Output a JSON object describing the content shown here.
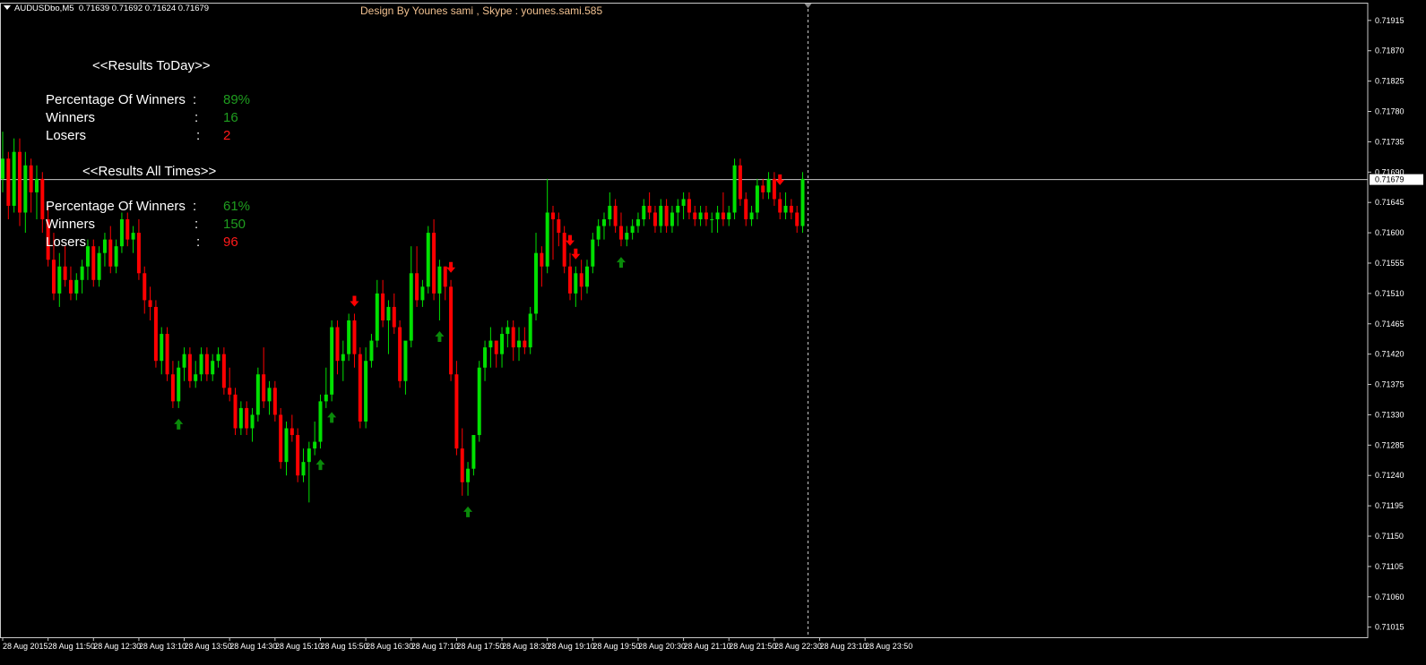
{
  "header": {
    "symbol": "AUDUSDbo,M5",
    "ohlc": "0.71639 0.71692 0.71624 0.71679",
    "design_credit": "Design By Younes sami , Skype : younes.sami.585"
  },
  "panel": {
    "today": {
      "title": "<<Results ToDay>>",
      "percentage_label": "Percentage Of Winners",
      "percentage_value": "89%",
      "winners_label": "Winners",
      "winners_value": "16",
      "losers_label": "Losers",
      "losers_value": "2"
    },
    "all_times": {
      "title": "<<Results All Times>>",
      "percentage_label": "Percentage Of Winners",
      "percentage_value": "61%",
      "winners_label": "Winners",
      "winners_value": "150",
      "losers_label": "Losers",
      "losers_value": "96"
    }
  },
  "colors": {
    "background": "#000000",
    "bull": "#00e000",
    "bear": "#ff0000",
    "up_arrow": "#0a8a0a",
    "down_arrow": "#ff0000",
    "axis": "#c8c8c8",
    "price_line": "#c8c8c8",
    "win_text": "#1f9d1f",
    "loss_text": "#ff1a1a"
  },
  "chart_data": {
    "type": "candlestick",
    "symbol": "AUDUSDbo",
    "timeframe": "M5",
    "ylim": [
      0.71,
      0.7194
    ],
    "y_ticks": [
      "0.71915",
      "0.71870",
      "0.71825",
      "0.71780",
      "0.71735",
      "0.71690",
      "0.71645",
      "0.71600",
      "0.71555",
      "0.71510",
      "0.71465",
      "0.71420",
      "0.71375",
      "0.71330",
      "0.71285",
      "0.71240",
      "0.71195",
      "0.71150",
      "0.71105",
      "0.71060",
      "0.71015"
    ],
    "x_ticks": [
      "28 Aug 2015",
      "28 Aug 11:50",
      "28 Aug 12:30",
      "28 Aug 13:10",
      "28 Aug 13:50",
      "28 Aug 14:30",
      "28 Aug 15:10",
      "28 Aug 15:50",
      "28 Aug 16:30",
      "28 Aug 17:10",
      "28 Aug 17:50",
      "28 Aug 18:30",
      "28 Aug 19:10",
      "28 Aug 19:50",
      "28 Aug 20:30",
      "28 Aug 21:10",
      "28 Aug 21:50",
      "28 Aug 22:30",
      "28 Aug 23:10",
      "28 Aug 23:50"
    ],
    "current_price": "0.71679",
    "bars_per_label": 8,
    "candles": [
      [
        0.7168,
        0.7175,
        0.7166,
        0.7171
      ],
      [
        0.7171,
        0.7172,
        0.7162,
        0.7164
      ],
      [
        0.7164,
        0.7174,
        0.7163,
        0.7172
      ],
      [
        0.7172,
        0.7174,
        0.7161,
        0.7163
      ],
      [
        0.7163,
        0.7172,
        0.716,
        0.717
      ],
      [
        0.717,
        0.7171,
        0.7163,
        0.7166
      ],
      [
        0.7166,
        0.717,
        0.7162,
        0.7168
      ],
      [
        0.7168,
        0.7169,
        0.716,
        0.7162
      ],
      [
        0.7162,
        0.7164,
        0.7155,
        0.7156
      ],
      [
        0.7156,
        0.716,
        0.715,
        0.7151
      ],
      [
        0.7151,
        0.7157,
        0.7149,
        0.7155
      ],
      [
        0.7155,
        0.7158,
        0.7152,
        0.7153
      ],
      [
        0.7153,
        0.7155,
        0.715,
        0.7151
      ],
      [
        0.7151,
        0.7154,
        0.715,
        0.7153
      ],
      [
        0.7153,
        0.7156,
        0.7151,
        0.7155
      ],
      [
        0.7155,
        0.7159,
        0.7153,
        0.7158
      ],
      [
        0.7158,
        0.7159,
        0.7152,
        0.7153
      ],
      [
        0.7153,
        0.7158,
        0.7152,
        0.7157
      ],
      [
        0.7157,
        0.716,
        0.7155,
        0.7159
      ],
      [
        0.7159,
        0.7161,
        0.7154,
        0.7155
      ],
      [
        0.7155,
        0.7159,
        0.7154,
        0.7158
      ],
      [
        0.7158,
        0.7163,
        0.7157,
        0.7162
      ],
      [
        0.7162,
        0.7163,
        0.7158,
        0.7159
      ],
      [
        0.7159,
        0.7161,
        0.7157,
        0.716
      ],
      [
        0.716,
        0.7162,
        0.7153,
        0.7154
      ],
      [
        0.7154,
        0.7155,
        0.7148,
        0.715
      ],
      [
        0.715,
        0.7152,
        0.7147,
        0.7149
      ],
      [
        0.7149,
        0.715,
        0.714,
        0.7141
      ],
      [
        0.7141,
        0.7146,
        0.7139,
        0.7145
      ],
      [
        0.7145,
        0.7146,
        0.7138,
        0.7139
      ],
      [
        0.7139,
        0.7141,
        0.7134,
        0.7135
      ],
      [
        0.7135,
        0.7141,
        0.7134,
        0.714
      ],
      [
        0.714,
        0.7143,
        0.7138,
        0.7142
      ],
      [
        0.7142,
        0.7143,
        0.7137,
        0.7138
      ],
      [
        0.7138,
        0.7141,
        0.7137,
        0.7139
      ],
      [
        0.7139,
        0.7143,
        0.7138,
        0.7142
      ],
      [
        0.7142,
        0.7143,
        0.7138,
        0.7139
      ],
      [
        0.7139,
        0.7142,
        0.7138,
        0.7141
      ],
      [
        0.7141,
        0.7143,
        0.714,
        0.7142
      ],
      [
        0.7142,
        0.7143,
        0.7136,
        0.7137
      ],
      [
        0.7137,
        0.714,
        0.7135,
        0.7136
      ],
      [
        0.7136,
        0.7137,
        0.713,
        0.7131
      ],
      [
        0.7131,
        0.7135,
        0.713,
        0.7134
      ],
      [
        0.7134,
        0.7135,
        0.713,
        0.7131
      ],
      [
        0.7131,
        0.7134,
        0.7129,
        0.7133
      ],
      [
        0.7133,
        0.714,
        0.7132,
        0.7139
      ],
      [
        0.7139,
        0.7143,
        0.7134,
        0.7135
      ],
      [
        0.7135,
        0.7138,
        0.7133,
        0.7137
      ],
      [
        0.7137,
        0.7138,
        0.7132,
        0.7133
      ],
      [
        0.7133,
        0.7134,
        0.7125,
        0.7126
      ],
      [
        0.7126,
        0.7132,
        0.7124,
        0.7131
      ],
      [
        0.7131,
        0.7133,
        0.7129,
        0.713
      ],
      [
        0.713,
        0.7131,
        0.7123,
        0.7124
      ],
      [
        0.7124,
        0.7128,
        0.7123,
        0.7126
      ],
      [
        0.7126,
        0.7129,
        0.712,
        0.7128
      ],
      [
        0.7128,
        0.7132,
        0.7127,
        0.7129
      ],
      [
        0.7129,
        0.7136,
        0.7128,
        0.7135
      ],
      [
        0.7135,
        0.714,
        0.7134,
        0.7136
      ],
      [
        0.7136,
        0.7147,
        0.7135,
        0.7146
      ],
      [
        0.7146,
        0.7147,
        0.7139,
        0.7141
      ],
      [
        0.7141,
        0.7144,
        0.7138,
        0.7142
      ],
      [
        0.7142,
        0.7148,
        0.7141,
        0.7147
      ],
      [
        0.7147,
        0.7148,
        0.714,
        0.7142
      ],
      [
        0.7142,
        0.7143,
        0.7131,
        0.7132
      ],
      [
        0.7132,
        0.7143,
        0.7131,
        0.7141
      ],
      [
        0.7141,
        0.7145,
        0.714,
        0.7144
      ],
      [
        0.7144,
        0.7153,
        0.7143,
        0.7151
      ],
      [
        0.7151,
        0.7153,
        0.7146,
        0.7147
      ],
      [
        0.7147,
        0.715,
        0.7142,
        0.7149
      ],
      [
        0.7149,
        0.7151,
        0.7145,
        0.7146
      ],
      [
        0.7146,
        0.7147,
        0.7137,
        0.7138
      ],
      [
        0.7138,
        0.7143,
        0.7136,
        0.7144
      ],
      [
        0.7144,
        0.7158,
        0.7143,
        0.7154
      ],
      [
        0.7154,
        0.7158,
        0.7149,
        0.715
      ],
      [
        0.715,
        0.7153,
        0.7149,
        0.7152
      ],
      [
        0.7152,
        0.7161,
        0.7151,
        0.716
      ],
      [
        0.716,
        0.7162,
        0.715,
        0.7151
      ],
      [
        0.7151,
        0.7156,
        0.7147,
        0.7155
      ],
      [
        0.7155,
        0.7155,
        0.715,
        0.7152
      ],
      [
        0.7152,
        0.7153,
        0.7138,
        0.7139
      ],
      [
        0.7139,
        0.7141,
        0.7127,
        0.7128
      ],
      [
        0.7128,
        0.7131,
        0.7121,
        0.7123
      ],
      [
        0.7123,
        0.7126,
        0.7121,
        0.7125
      ],
      [
        0.7125,
        0.713,
        0.7124,
        0.713
      ],
      [
        0.713,
        0.7141,
        0.7129,
        0.714
      ],
      [
        0.714,
        0.7144,
        0.7138,
        0.7143
      ],
      [
        0.7143,
        0.7146,
        0.714,
        0.7144
      ],
      [
        0.7144,
        0.7144,
        0.714,
        0.7142
      ],
      [
        0.7142,
        0.7146,
        0.714,
        0.7145
      ],
      [
        0.7145,
        0.7147,
        0.7143,
        0.7146
      ],
      [
        0.7146,
        0.7147,
        0.7141,
        0.7143
      ],
      [
        0.7143,
        0.7146,
        0.7141,
        0.7144
      ],
      [
        0.7144,
        0.7146,
        0.7142,
        0.7143
      ],
      [
        0.7143,
        0.7149,
        0.7142,
        0.7148
      ],
      [
        0.7148,
        0.716,
        0.7147,
        0.7157
      ],
      [
        0.7157,
        0.7158,
        0.7152,
        0.7155
      ],
      [
        0.7155,
        0.7168,
        0.7154,
        0.7163
      ],
      [
        0.7163,
        0.7164,
        0.7156,
        0.7162
      ],
      [
        0.7162,
        0.7163,
        0.7158,
        0.716
      ],
      [
        0.716,
        0.7161,
        0.7154,
        0.7155
      ],
      [
        0.7155,
        0.7157,
        0.715,
        0.7151
      ],
      [
        0.7151,
        0.7155,
        0.7149,
        0.7154
      ],
      [
        0.7154,
        0.7156,
        0.715,
        0.7152
      ],
      [
        0.7152,
        0.7156,
        0.7151,
        0.7155
      ],
      [
        0.7155,
        0.716,
        0.7154,
        0.7159
      ],
      [
        0.7159,
        0.7162,
        0.7158,
        0.7161
      ],
      [
        0.7161,
        0.7163,
        0.7159,
        0.7162
      ],
      [
        0.7162,
        0.7166,
        0.7161,
        0.7164
      ],
      [
        0.7164,
        0.7165,
        0.716,
        0.7161
      ],
      [
        0.7161,
        0.7163,
        0.7158,
        0.7159
      ],
      [
        0.7159,
        0.7161,
        0.7158,
        0.716
      ],
      [
        0.716,
        0.7162,
        0.7159,
        0.7161
      ],
      [
        0.7161,
        0.7163,
        0.716,
        0.7162
      ],
      [
        0.7162,
        0.7165,
        0.7161,
        0.7164
      ],
      [
        0.7164,
        0.7166,
        0.7162,
        0.7163
      ],
      [
        0.7163,
        0.7164,
        0.716,
        0.7161
      ],
      [
        0.7161,
        0.7165,
        0.716,
        0.7164
      ],
      [
        0.7164,
        0.7165,
        0.716,
        0.7161
      ],
      [
        0.7161,
        0.7164,
        0.716,
        0.7163
      ],
      [
        0.7163,
        0.7165,
        0.7161,
        0.7164
      ],
      [
        0.7164,
        0.7166,
        0.7162,
        0.7165
      ],
      [
        0.7165,
        0.7166,
        0.7162,
        0.7163
      ],
      [
        0.7163,
        0.7164,
        0.7161,
        0.7162
      ],
      [
        0.7162,
        0.7164,
        0.7161,
        0.7163
      ],
      [
        0.7163,
        0.7164,
        0.7161,
        0.7162
      ],
      [
        0.7162,
        0.7163,
        0.716,
        0.7162
      ],
      [
        0.7162,
        0.7164,
        0.716,
        0.7163
      ],
      [
        0.7163,
        0.7166,
        0.7161,
        0.7162
      ],
      [
        0.7162,
        0.7164,
        0.7161,
        0.7163
      ],
      [
        0.7163,
        0.7171,
        0.7162,
        0.717
      ],
      [
        0.717,
        0.7171,
        0.7164,
        0.7165
      ],
      [
        0.7165,
        0.7166,
        0.7161,
        0.7162
      ],
      [
        0.7162,
        0.7164,
        0.7161,
        0.7163
      ],
      [
        0.7163,
        0.7168,
        0.7162,
        0.7167
      ],
      [
        0.7167,
        0.7168,
        0.7165,
        0.7166
      ],
      [
        0.7166,
        0.7169,
        0.7165,
        0.7168
      ],
      [
        0.7168,
        0.7169,
        0.7164,
        0.7165
      ],
      [
        0.7165,
        0.7166,
        0.7162,
        0.7163
      ],
      [
        0.7163,
        0.7166,
        0.7162,
        0.7164
      ],
      [
        0.7164,
        0.7165,
        0.7162,
        0.7163
      ],
      [
        0.7163,
        0.7164,
        0.716,
        0.7161
      ],
      [
        0.7161,
        0.7169,
        0.716,
        0.7168
      ]
    ],
    "up_arrows_at": [
      31,
      56,
      58,
      77,
      82,
      109
    ],
    "down_arrows_at": [
      62,
      79,
      100,
      101,
      137
    ]
  }
}
